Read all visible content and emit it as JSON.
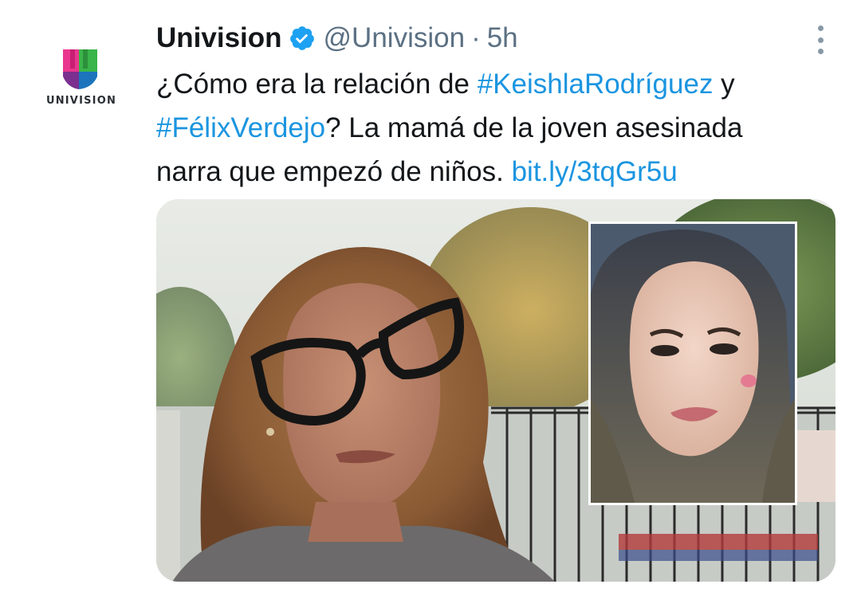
{
  "tweet": {
    "display_name": "Univision",
    "handle": "@Univision",
    "separator": "·",
    "time": "5h",
    "avatar_wordmark": "UNIVISION",
    "text": {
      "q_open": "¿Cómo era la relación de ",
      "hashtag1": "#KeishlaRodríguez",
      "and": " y",
      "hashtag2": "#FélixVerdejo",
      "after_hashtag2": "? La mamá de la joven asesinada",
      "line3": "narra que empezó de niños. ",
      "link": "bit.ly/3tqGr5u"
    }
  },
  "icons": {
    "verified": "verified-badge-icon",
    "more": "more-options-icon"
  },
  "colors": {
    "link": "#1b95e0",
    "text": "#14171a",
    "muted": "#5b7083",
    "verified": "#1da1f2"
  }
}
